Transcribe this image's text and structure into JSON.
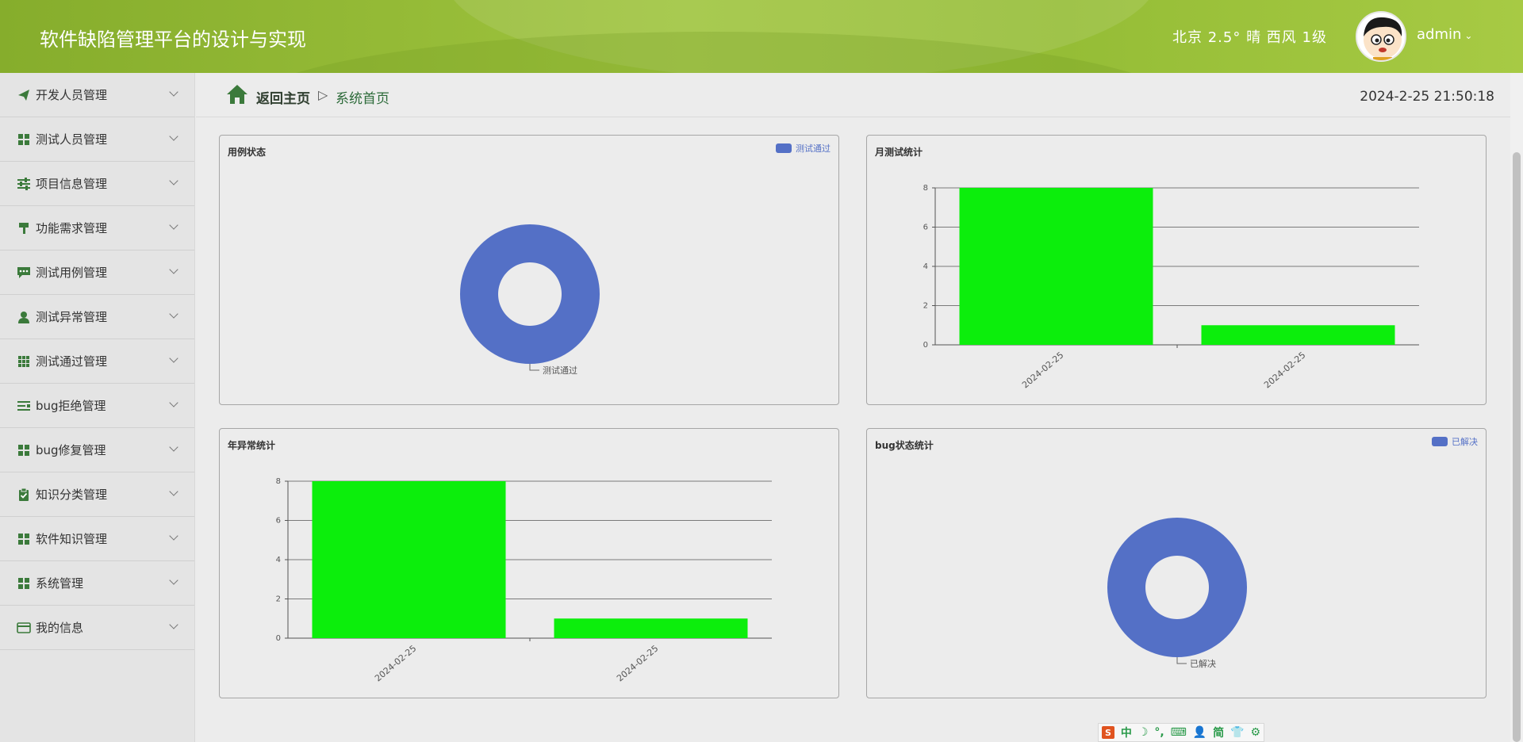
{
  "header": {
    "title": "软件缺陷管理平台的设计与实现",
    "weather": "北京  2.5°  晴  西风  1级",
    "user": "admin",
    "caret": "⌄"
  },
  "sidebar": {
    "items": [
      {
        "label": "开发人员管理",
        "icon": "paper-plane-icon"
      },
      {
        "label": "测试人员管理",
        "icon": "grid-icon"
      },
      {
        "label": "项目信息管理",
        "icon": "sliders-icon"
      },
      {
        "label": "功能需求管理",
        "icon": "paint-roller-icon"
      },
      {
        "label": "测试用例管理",
        "icon": "comment-icon"
      },
      {
        "label": "测试异常管理",
        "icon": "user-icon"
      },
      {
        "label": "测试通过管理",
        "icon": "grid-nine-icon"
      },
      {
        "label": "bug拒绝管理",
        "icon": "list-icon"
      },
      {
        "label": "bug修复管理",
        "icon": "grid-icon"
      },
      {
        "label": "知识分类管理",
        "icon": "clipboard-check-icon"
      },
      {
        "label": "软件知识管理",
        "icon": "grid-icon"
      },
      {
        "label": "系统管理",
        "icon": "grid-icon"
      },
      {
        "label": "我的信息",
        "icon": "id-card-icon"
      }
    ]
  },
  "breadcrumb": {
    "home": "返回主页",
    "separator": "▷",
    "current": "系统首页",
    "datetime": "2024-2-25 21:50:18"
  },
  "ime": {
    "items": [
      "中",
      "☽",
      "°,",
      "⌨",
      "👤",
      "简",
      "👕",
      "⚙"
    ],
    "logo": "S"
  },
  "colors": {
    "header_green": "#9fc43e",
    "sidebar_icon_green": "#3b7a3b",
    "bar_green": "#0cee0c",
    "donut_blue": "#5470c6"
  },
  "chart_data": [
    {
      "type": "pie",
      "title": "用例状态",
      "labels": [
        "测试通过"
      ],
      "values": [
        1
      ],
      "legend": "top-right",
      "donut": true
    },
    {
      "type": "bar",
      "title": "月测试统计",
      "categories": [
        "2024-02-25",
        "2024-02-25"
      ],
      "values": [
        8,
        1
      ],
      "ylim": [
        0,
        8
      ],
      "yticks": [
        "0",
        "2",
        "4",
        "6",
        "8"
      ],
      "grid": true
    },
    {
      "type": "bar",
      "title": "年异常统计",
      "categories": [
        "2024-02-25",
        "2024-02-25"
      ],
      "values": [
        8,
        1
      ],
      "ylim": [
        0,
        8
      ],
      "yticks": [
        "0",
        "2",
        "4",
        "6",
        "8"
      ],
      "grid": true
    },
    {
      "type": "pie",
      "title": "bug状态统计",
      "labels": [
        "已解决"
      ],
      "values": [
        1
      ],
      "legend": "top-right",
      "donut": true
    }
  ]
}
